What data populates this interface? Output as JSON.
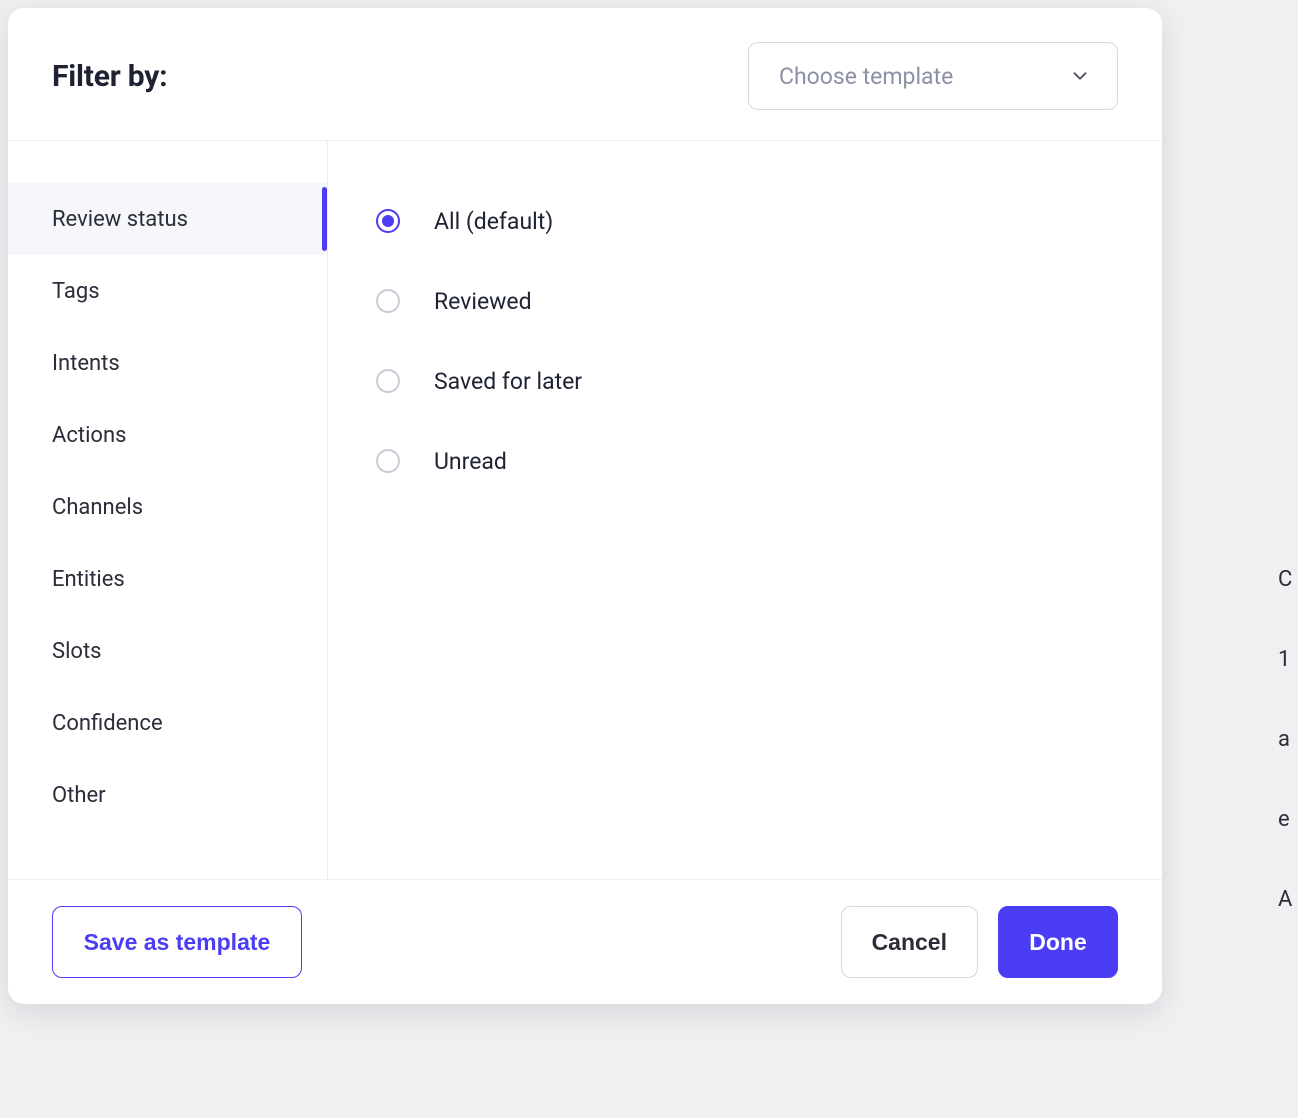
{
  "header": {
    "title": "Filter by:",
    "template_placeholder": "Choose template"
  },
  "sidebar": {
    "active_index": 0,
    "items": [
      {
        "label": "Review status"
      },
      {
        "label": "Tags"
      },
      {
        "label": "Intents"
      },
      {
        "label": "Actions"
      },
      {
        "label": "Channels"
      },
      {
        "label": "Entities"
      },
      {
        "label": "Slots"
      },
      {
        "label": "Confidence"
      },
      {
        "label": "Other"
      }
    ]
  },
  "options": {
    "selected_index": 0,
    "items": [
      {
        "label": "All (default)"
      },
      {
        "label": "Reviewed"
      },
      {
        "label": "Saved for later"
      },
      {
        "label": "Unread"
      }
    ]
  },
  "footer": {
    "save_template_label": "Save as template",
    "cancel_label": "Cancel",
    "done_label": "Done"
  },
  "colors": {
    "accent": "#4b3df3"
  }
}
